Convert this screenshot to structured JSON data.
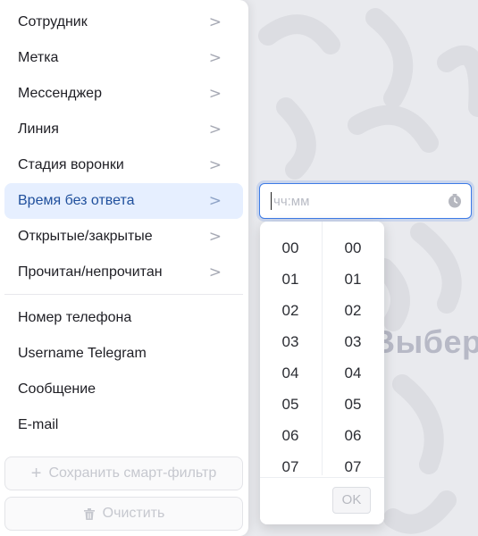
{
  "menu": {
    "items": [
      {
        "label": "Сотрудник",
        "chevron": ">"
      },
      {
        "label": "Метка",
        "chevron": ">"
      },
      {
        "label": "Мессенджер",
        "chevron": ">"
      },
      {
        "label": "Линия",
        "chevron": ">"
      },
      {
        "label": "Стадия воронки",
        "chevron": ">"
      },
      {
        "label": "Время без ответа",
        "chevron": ">",
        "active": true
      },
      {
        "label": "Открытые/закрытые",
        "chevron": ">"
      },
      {
        "label": "Прочитан/непрочитан",
        "chevron": ">"
      }
    ],
    "fields": [
      {
        "label": "Номер телефона"
      },
      {
        "label": "Username Telegram"
      },
      {
        "label": "Сообщение"
      },
      {
        "label": "E-mail"
      }
    ],
    "save_button": {
      "icon": "+",
      "label": "Сохранить смарт-фильтр"
    },
    "clear_button": {
      "icon": "trash-icon",
      "label": "Очистить"
    }
  },
  "time_input": {
    "placeholder": "чч:мм",
    "icon": "clock-icon"
  },
  "time_picker": {
    "hours": [
      "00",
      "01",
      "02",
      "03",
      "04",
      "05",
      "06",
      "07"
    ],
    "minutes": [
      "00",
      "01",
      "02",
      "03",
      "04",
      "05",
      "06",
      "07"
    ],
    "ok_label": "OK"
  },
  "background": {
    "partial_text": "Выбер"
  },
  "colors": {
    "accent": "#3d7be6",
    "active_item_bg": "#e6efff",
    "background": "#e9eaee"
  }
}
